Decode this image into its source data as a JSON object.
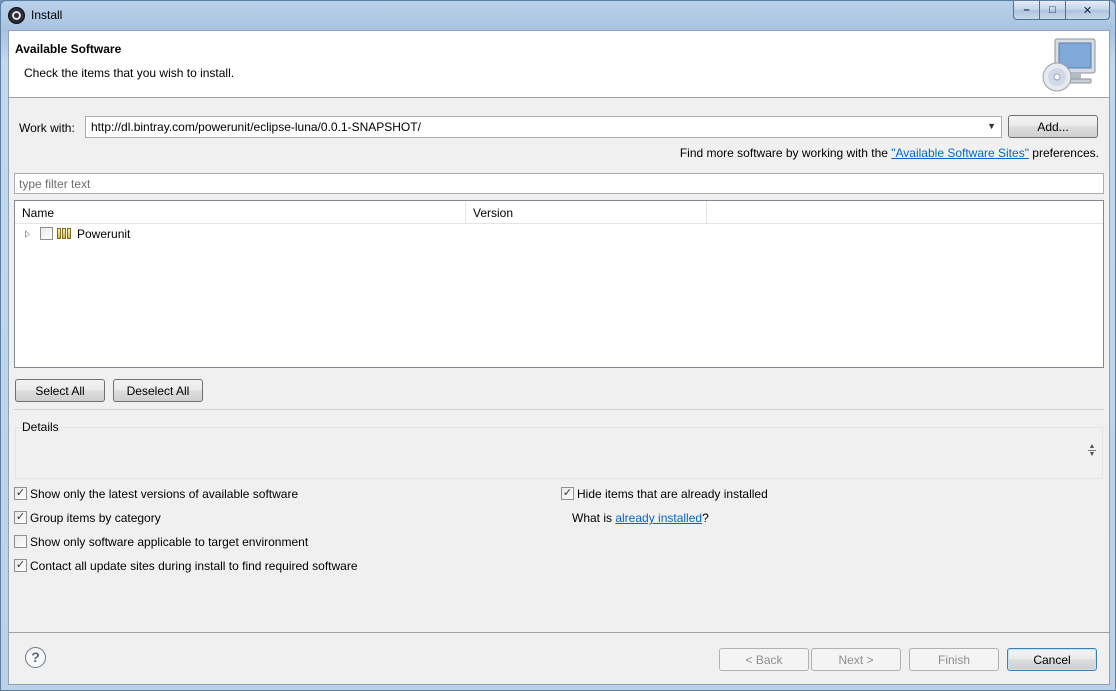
{
  "window": {
    "title": "Install",
    "controls": {
      "minimize": "–",
      "maximize": "□",
      "close": "✕"
    },
    "icon": "eclipse-icon"
  },
  "banner": {
    "title": "Available Software",
    "subtitle": "Check the items that you wish to install.",
    "icon": "cd-monitor-icon"
  },
  "work_with": {
    "label": "Work with:",
    "value": "http://dl.bintray.com/powerunit/eclipse-luna/0.0.1-SNAPSHOT/",
    "add_label": "Add..."
  },
  "more_software": {
    "prefix": "Find more software by working with the ",
    "link": "\"Available Software Sites\"",
    "suffix": " preferences."
  },
  "filter": {
    "placeholder": "type filter text",
    "value": ""
  },
  "tree": {
    "columns": [
      "Name",
      "Version"
    ],
    "items": [
      {
        "name": "Powerunit",
        "version": "",
        "checked": false,
        "expanded": false,
        "icon": "feature-group-icon"
      }
    ]
  },
  "selection": {
    "select_all": "Select All",
    "deselect_all": "Deselect All"
  },
  "details": {
    "title": "Details",
    "text": ""
  },
  "options": {
    "latest_versions": {
      "label": "Show only the latest versions of available software",
      "checked": true
    },
    "group_by_category": {
      "label": "Group items by category",
      "checked": true
    },
    "applicable_only": {
      "label": "Show only software applicable to target environment",
      "checked": false
    },
    "contact_sites": {
      "label": "Contact all update sites during install to find required software",
      "checked": true
    },
    "hide_installed": {
      "label": "Hide items that are already installed",
      "checked": true
    },
    "what_is": {
      "prefix": "What is ",
      "link": "already installed",
      "suffix": "?"
    }
  },
  "footer": {
    "help": "?",
    "back": "< Back",
    "next": "Next >",
    "finish": "Finish",
    "cancel": "Cancel"
  },
  "colors": {
    "link": "#0066cc",
    "banner_bg": "#ffffff",
    "dialog_bg": "#f0f0f0"
  }
}
